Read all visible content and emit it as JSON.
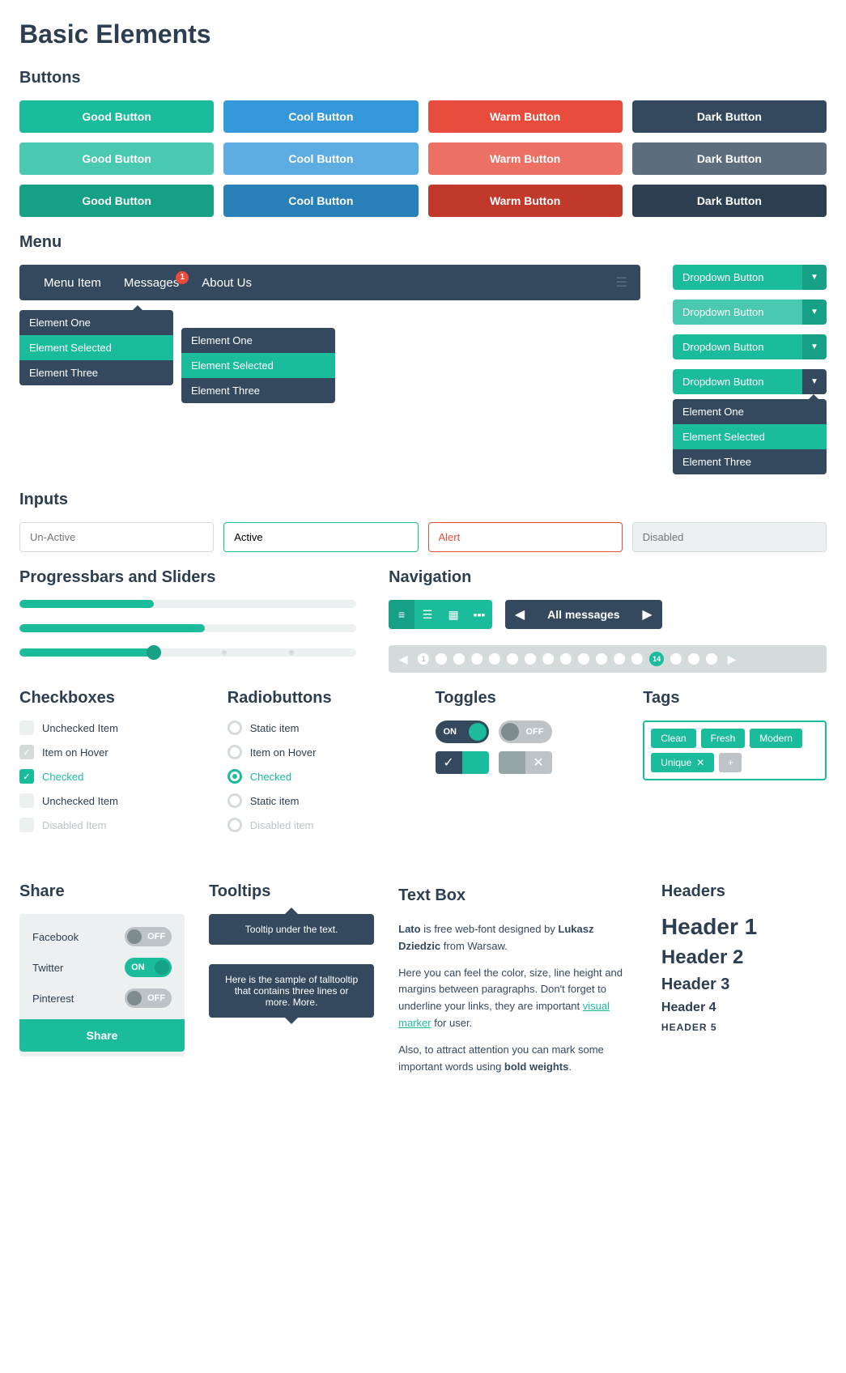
{
  "title": "Basic Elements",
  "sections": {
    "buttons": "Buttons",
    "menu": "Menu",
    "inputs": "Inputs",
    "progress": "Progressbars and Sliders",
    "navigation": "Navigation",
    "checkboxes": "Checkboxes",
    "radiobuttons": "Radiobuttons",
    "toggles": "Toggles",
    "tags": "Tags",
    "share": "Share",
    "tooltips": "Tooltips",
    "textbox": "Text Box",
    "headers": "Headers"
  },
  "buttons": {
    "good": "Good Button",
    "cool": "Cool Button",
    "warm": "Warm Button",
    "dark": "Dark Button"
  },
  "menu": {
    "items": [
      "Menu Item",
      "Messages",
      "About Us"
    ],
    "badge": "1",
    "dropdown_items": [
      "Element One",
      "Element Selected",
      "Element Three"
    ],
    "dd_button": "Dropdown Button"
  },
  "inputs": {
    "unactive": "Un-Active",
    "active": "Active",
    "alert": "Alert",
    "disabled": "Disabled"
  },
  "progress": {
    "bar1": 40,
    "bar2": 55,
    "slider": 40
  },
  "navigation": {
    "all_messages": "All messages",
    "page_active": "14",
    "page_first": "1"
  },
  "checkboxes": {
    "items": [
      "Unchecked Item",
      "Item on Hover",
      "Checked",
      "Unchecked Item",
      "Disabled Item"
    ]
  },
  "radios": {
    "items": [
      "Static item",
      "Item on Hover",
      "Checked",
      "Static item",
      "Disabled item"
    ]
  },
  "toggles": {
    "on": "ON",
    "off": "OFF"
  },
  "tags": {
    "items": [
      "Clean",
      "Fresh",
      "Modern",
      "Unique"
    ]
  },
  "share": {
    "items": [
      "Facebook",
      "Twitter",
      "Pinterest"
    ],
    "button": "Share"
  },
  "tooltips": {
    "short": "Tooltip under the text.",
    "long": "Here is the sample of talltooltip that contains three lines or more. More."
  },
  "textbox": {
    "p1a": "Lato",
    "p1b": " is free web-font designed by  ",
    "p1c": "Lukasz Dziedzic",
    "p1d": " from Warsaw.",
    "p2a": "Here you can feel the color, size, line height and margins between paragraphs. Don't forget to underline your links, they are important ",
    "p2b": "visual marker",
    "p2c": " for user.",
    "p3a": "Also, to attract attention you can mark some important words using ",
    "p3b": "bold weights",
    "p3c": "."
  },
  "headers": {
    "h1": "Header 1",
    "h2": "Header 2",
    "h3": "Header 3",
    "h4": "Header 4",
    "h5": "HEADER 5"
  }
}
